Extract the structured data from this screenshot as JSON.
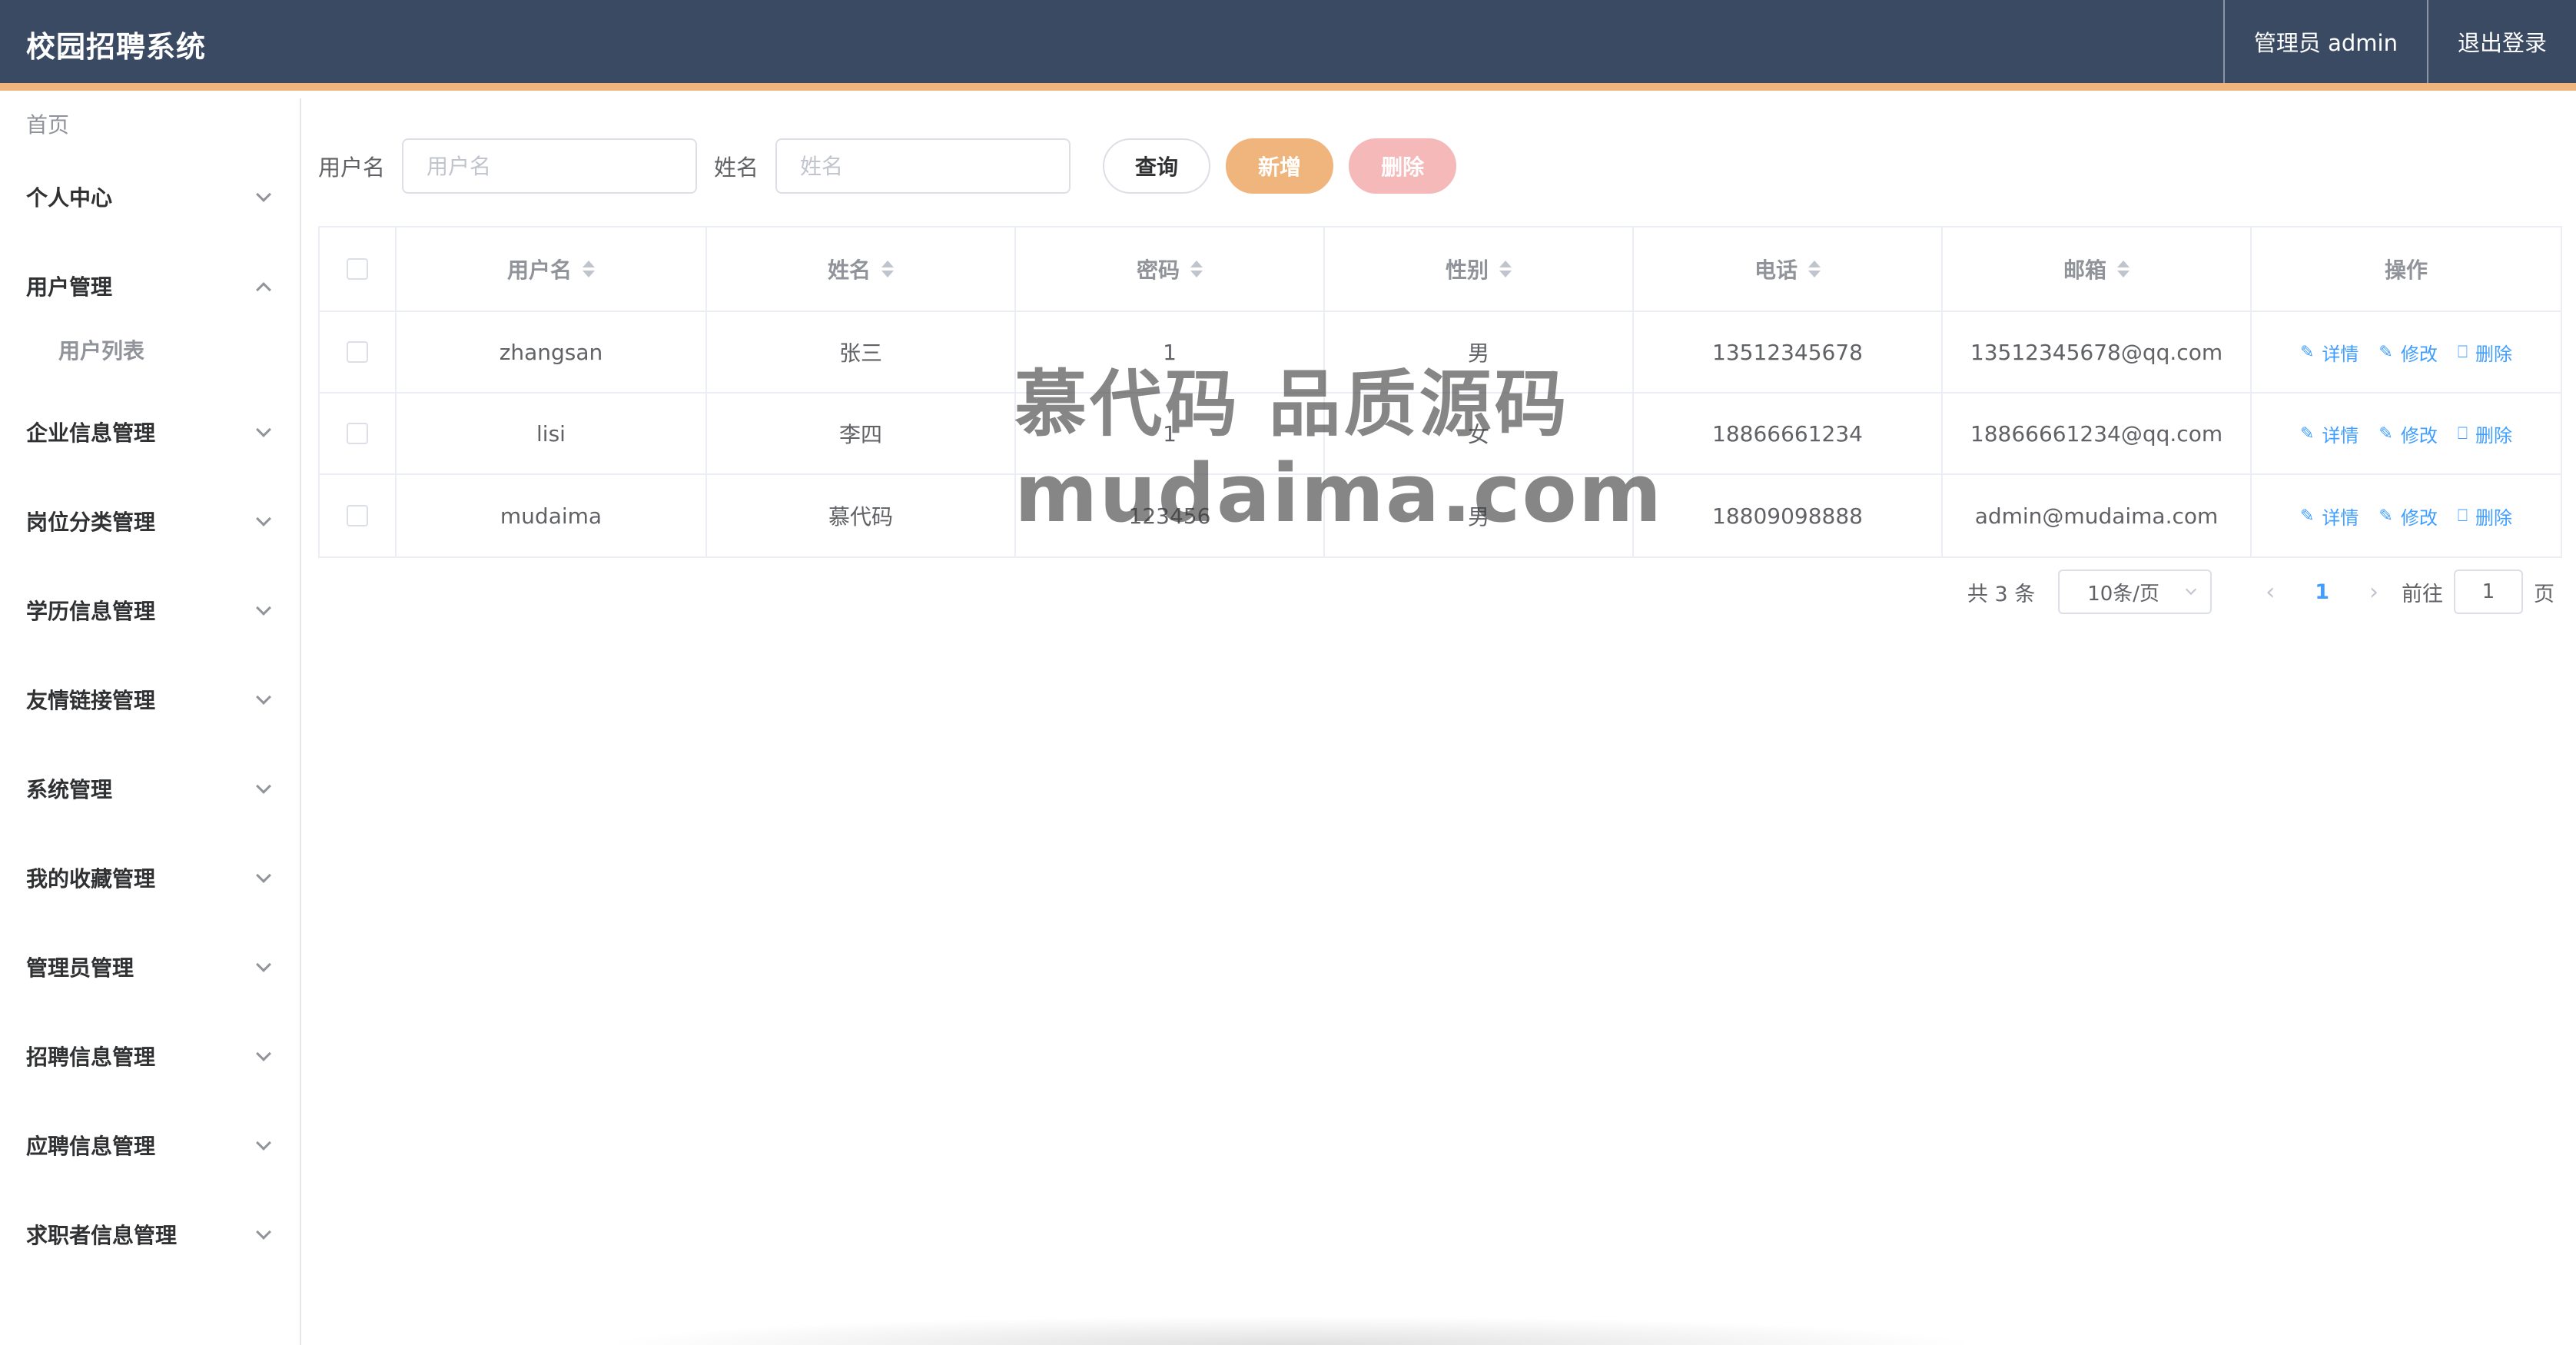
{
  "app": {
    "title": "校园招聘系统"
  },
  "header": {
    "user_label": "管理员 admin",
    "logout_label": "退出登录"
  },
  "sidebar": {
    "home": "首页",
    "groups": [
      {
        "label": "个人中心"
      },
      {
        "label": "用户管理",
        "expanded": true,
        "children": [
          "用户列表"
        ]
      },
      {
        "label": "企业信息管理"
      },
      {
        "label": "岗位分类管理"
      },
      {
        "label": "学历信息管理"
      },
      {
        "label": "友情链接管理"
      },
      {
        "label": "系统管理"
      },
      {
        "label": "我的收藏管理"
      },
      {
        "label": "管理员管理"
      },
      {
        "label": "招聘信息管理"
      },
      {
        "label": "应聘信息管理"
      },
      {
        "label": "求职者信息管理"
      }
    ]
  },
  "search": {
    "username_label": "用户名",
    "username_placeholder": "用户名",
    "name_label": "姓名",
    "name_placeholder": "姓名",
    "query_button": "查询",
    "add_button": "新增",
    "delete_button": "删除"
  },
  "table": {
    "columns": [
      "用户名",
      "姓名",
      "密码",
      "性别",
      "电话",
      "邮箱",
      "操作"
    ],
    "rows": [
      {
        "username": "zhangsan",
        "name": "张三",
        "password": "1",
        "gender": "男",
        "phone": "13512345678",
        "email": "13512345678@qq.com"
      },
      {
        "username": "lisi",
        "name": "李四",
        "password": "1",
        "gender": "女",
        "phone": "18866661234",
        "email": "18866661234@qq.com"
      },
      {
        "username": "mudaima",
        "name": "慕代码",
        "password": "123456",
        "gender": "男",
        "phone": "18809098888",
        "email": "admin@mudaima.com"
      }
    ],
    "actions": {
      "detail": "详情",
      "edit": "修改",
      "delete": "删除"
    }
  },
  "pagination": {
    "total_text": "共 3 条",
    "page_size": "10条/页",
    "current_page": "1",
    "goto_label": "前往",
    "goto_value": "1",
    "page_suffix": "页"
  },
  "watermark": {
    "line1": "慕代码 品质源码",
    "line2": "mudaima.com"
  },
  "colors": {
    "header_bg": "#3b4a63",
    "accent_orange": "#f0b57d",
    "delete_pink": "#f4b9b8",
    "link_blue": "#409eff"
  }
}
